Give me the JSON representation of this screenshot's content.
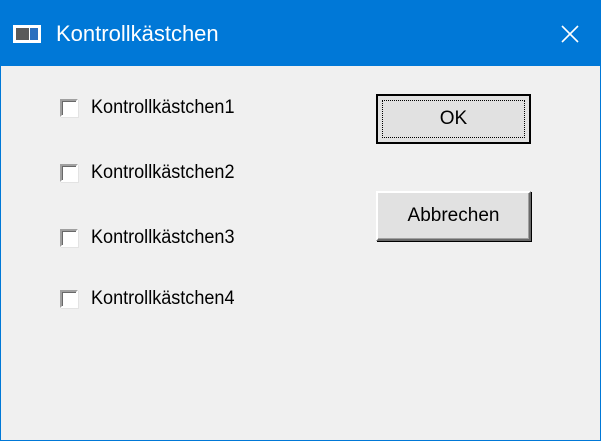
{
  "window": {
    "title": "Kontrollkästchen"
  },
  "checkboxes": [
    {
      "label": "Kontrollkästchen1",
      "checked": false
    },
    {
      "label": "Kontrollkästchen2",
      "checked": false
    },
    {
      "label": "Kontrollkästchen3",
      "checked": false
    },
    {
      "label": "Kontrollkästchen4",
      "checked": false
    }
  ],
  "buttons": {
    "ok_label": "OK",
    "cancel_label": "Abbrechen"
  },
  "icons": {
    "app": "app-window-icon",
    "close": "close-icon"
  },
  "colors": {
    "titlebar": "#0078d7",
    "background": "#f0f0f0"
  }
}
